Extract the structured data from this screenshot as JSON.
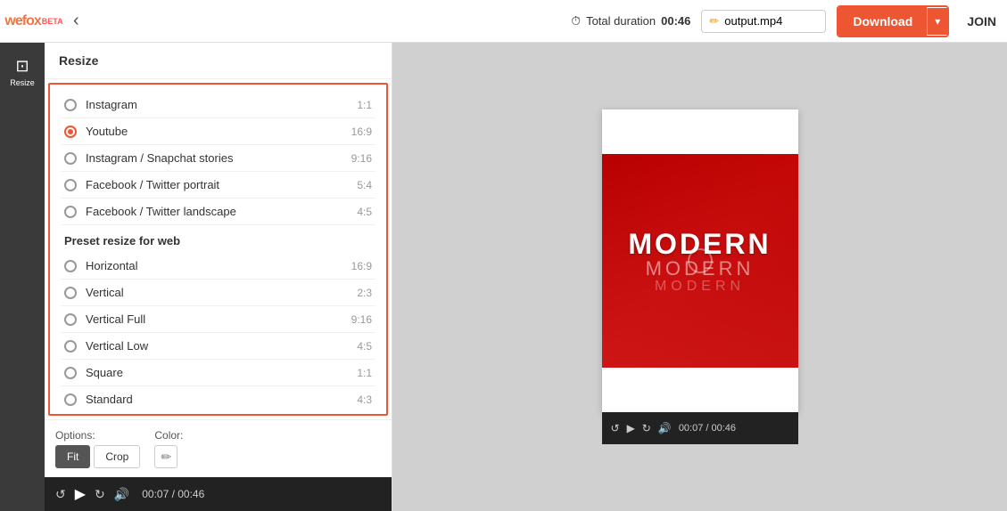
{
  "header": {
    "logo_text": "wefox",
    "logo_beta": "BETA",
    "back_label": "‹",
    "duration_label": "Total duration",
    "duration_value": "00:46",
    "filename": "output.mp4",
    "download_label": "Download",
    "download_arrow": "▾",
    "join_label": "JOIN"
  },
  "sidebar": {
    "items": [
      {
        "id": "resize",
        "icon": "⊡",
        "label": "Resize",
        "active": true
      }
    ]
  },
  "panel": {
    "title": "Resize",
    "options": [
      {
        "id": "instagram",
        "label": "Instagram",
        "ratio": "1:1",
        "selected": false
      },
      {
        "id": "youtube",
        "label": "Youtube",
        "ratio": "16:9",
        "selected": true
      },
      {
        "id": "instagram-stories",
        "label": "Instagram / Snapchat stories",
        "ratio": "9:16",
        "selected": false
      },
      {
        "id": "facebook-portrait",
        "label": "Facebook / Twitter portrait",
        "ratio": "5:4",
        "selected": false
      },
      {
        "id": "facebook-landscape",
        "label": "Facebook / Twitter landscape",
        "ratio": "4:5",
        "selected": false
      }
    ],
    "web_section_title": "Preset resize for web",
    "web_options": [
      {
        "id": "horizontal",
        "label": "Horizontal",
        "ratio": "16:9",
        "selected": false
      },
      {
        "id": "vertical",
        "label": "Vertical",
        "ratio": "2:3",
        "selected": false
      },
      {
        "id": "vertical-full",
        "label": "Vertical Full",
        "ratio": "9:16",
        "selected": false
      },
      {
        "id": "vertical-low",
        "label": "Vertical Low",
        "ratio": "4:5",
        "selected": false
      },
      {
        "id": "square",
        "label": "Square",
        "ratio": "1:1",
        "selected": false
      },
      {
        "id": "standard",
        "label": "Standard",
        "ratio": "4:3",
        "selected": false
      }
    ],
    "options_label": "Options:",
    "color_label": "Color:",
    "fit_label": "Fit",
    "crop_label": "Crop"
  },
  "preview": {
    "modern_title": "MODERN",
    "modern_subtitle": "MODERN",
    "modern_subtitle2": "MODERN",
    "time_current": "00:07",
    "time_total": "00:46",
    "time_display": "00:07 / 00:46"
  },
  "bottom_bar": {
    "time_display": "00:07 / 00:46"
  }
}
